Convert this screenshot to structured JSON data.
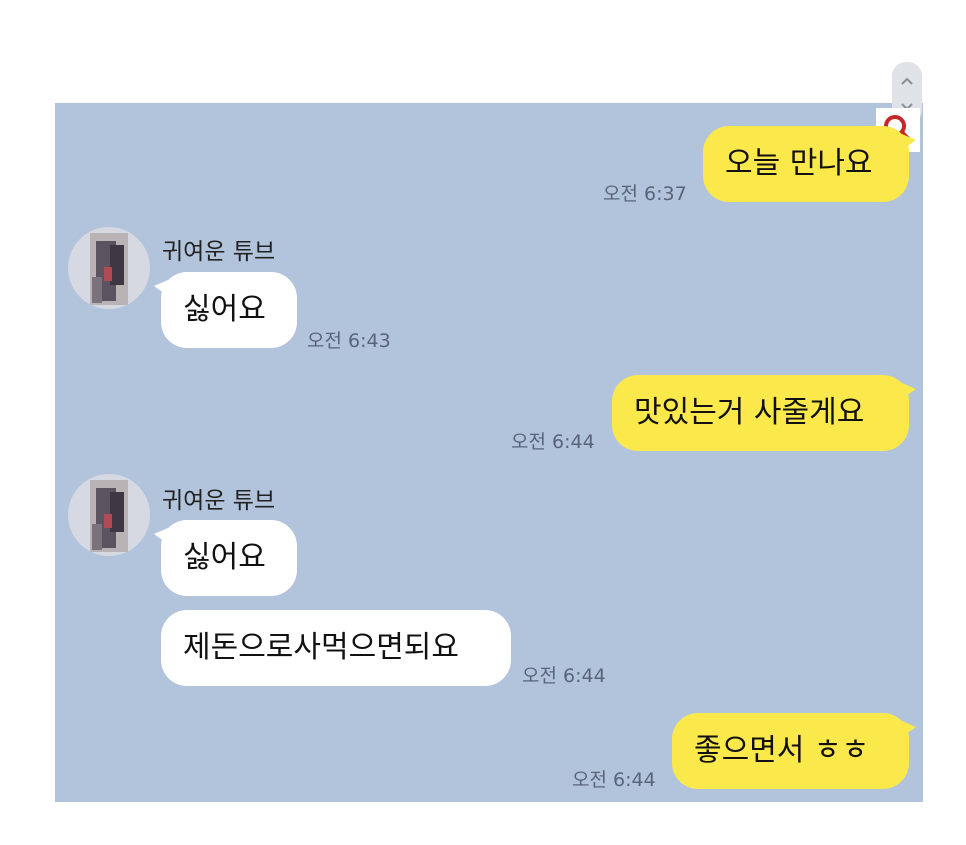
{
  "chat": {
    "messages": [
      {
        "id": "m1",
        "side": "mine",
        "text": "오늘 만나요",
        "time": "오전 6:37"
      },
      {
        "id": "m2",
        "side": "theirs",
        "sender": "귀여운 튜브",
        "text": "싫어요",
        "time": "오전 6:43"
      },
      {
        "id": "m3",
        "side": "mine",
        "text": "맛있는거 사줄게요",
        "time": "오전 6:44"
      },
      {
        "id": "m4",
        "side": "theirs",
        "sender": "귀여운 튜브",
        "text": "싫어요"
      },
      {
        "id": "m5",
        "side": "theirs",
        "text": "제돈으로사먹으면되요",
        "time": "오전 6:44"
      },
      {
        "id": "m6",
        "side": "mine",
        "text": "좋으면서 ㅎㅎ",
        "time": "오전 6:44"
      }
    ]
  },
  "controls": {
    "scroll_up_icon": "chevron-up-icon",
    "scroll_down_icon": "chevron-down-icon",
    "search_icon": "search-icon"
  },
  "colors": {
    "chat_background": "#b2c4dc",
    "my_bubble": "#fbe84a",
    "their_bubble": "#ffffff",
    "search_icon": "#c62828"
  }
}
